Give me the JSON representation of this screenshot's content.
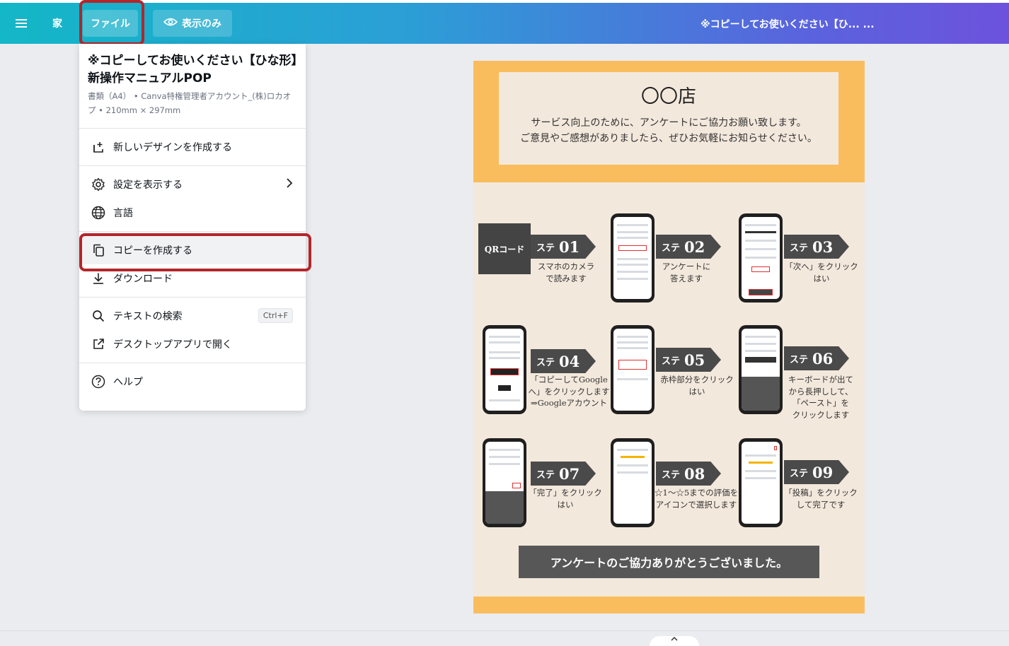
{
  "topbar": {
    "menu_icon": "hamburger-icon",
    "home_label": "家",
    "file_label": "ファイル",
    "view_label": "表示のみ",
    "view_icon": "eye-icon",
    "doc_title": "※コピーしてお使いください【ひ... ..."
  },
  "menu": {
    "title": "※コピーしてお使いください【ひな形】新操作マニュアルPOP",
    "subtitle": "書類（A4） • Canva特権管理者アカウント_(株)ロカオプ • 210mm × 297mm",
    "items": [
      {
        "label": "新しいデザインを作成する",
        "icon": "new-design-icon"
      },
      {
        "label": "設定を表示する",
        "icon": "gear-icon"
      },
      {
        "label": "言語",
        "icon": "globe-icon"
      },
      {
        "label": "コピーを作成する",
        "icon": "copy-icon"
      },
      {
        "label": "ダウンロード",
        "icon": "download-icon"
      },
      {
        "label": "テキストの検索",
        "icon": "search-icon",
        "shortcut": "Ctrl+F"
      },
      {
        "label": "デスクトップアプリで開く",
        "icon": "external-link-icon"
      },
      {
        "label": "ヘルプ",
        "icon": "help-icon"
      }
    ]
  },
  "doc": {
    "store": "〇〇店",
    "line1": "サービス向上のために、アンケートにご協力お願い致します。",
    "line2": "ご意見やご感想がありましたら、ぜひお気軽にお知らせください。",
    "qr": "QRコード",
    "step_prefix": "ステ",
    "steps": [
      {
        "num": "01",
        "caption": [
          "スマホのカメラ",
          "で読みます"
        ]
      },
      {
        "num": "02",
        "caption": [
          "アンケートに",
          "答えます"
        ]
      },
      {
        "num": "03",
        "caption": [
          "「次へ」をクリック",
          "はい"
        ]
      },
      {
        "num": "04",
        "caption": [
          "「コピーしてGoogle",
          "へ」をクリックします",
          "⇒Googleアカウント"
        ]
      },
      {
        "num": "05",
        "caption": [
          "赤枠部分をクリック",
          "はい"
        ]
      },
      {
        "num": "06",
        "caption": [
          "キーボードが出て",
          "から長押しして、",
          "「ペースト」を",
          "クリックします"
        ]
      },
      {
        "num": "07",
        "caption": [
          "「完了」をクリック",
          "はい"
        ]
      },
      {
        "num": "08",
        "caption": [
          "☆1〜☆5までの評価を",
          "アイコンで選択します"
        ]
      },
      {
        "num": "09",
        "caption": [
          "「投稿」をクリック",
          "して完了です"
        ]
      }
    ],
    "thanks": "アンケートのご協力ありがとうございました。"
  }
}
